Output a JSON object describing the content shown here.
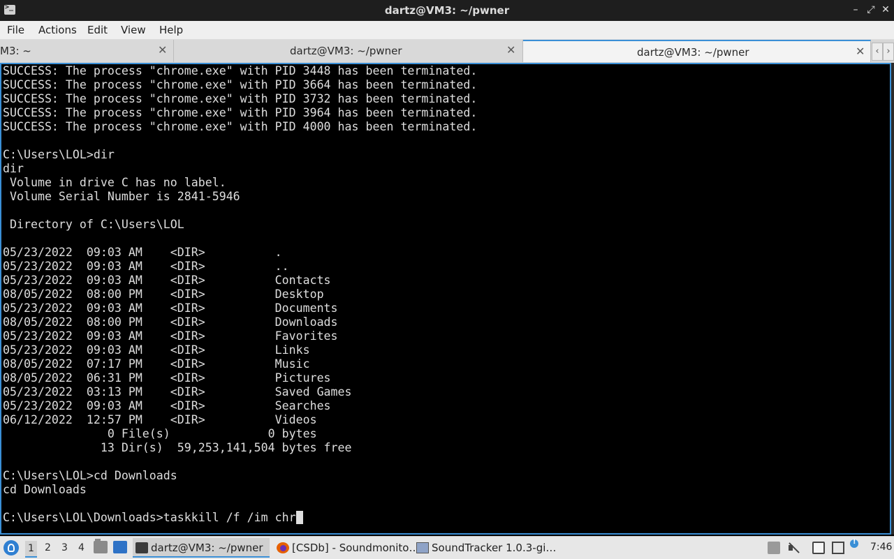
{
  "window": {
    "title": "dartz@VM3: ~/pwner",
    "controls": {
      "minimize": "–",
      "maximize": "⤢",
      "close": "✕"
    }
  },
  "menu": [
    "File",
    "Actions",
    "Edit",
    "View",
    "Help"
  ],
  "tabs": [
    {
      "label": "M3: ~",
      "close": "✕",
      "active": false
    },
    {
      "label": "dartz@VM3: ~/pwner",
      "close": "✕",
      "active": false
    },
    {
      "label": "dartz@VM3: ~/pwner",
      "close": "✕",
      "active": true
    }
  ],
  "tab_nav": {
    "left": "‹",
    "right": "›"
  },
  "terminal": {
    "lines": [
      "SUCCESS: The process \"chrome.exe\" with PID 3448 has been terminated.",
      "SUCCESS: The process \"chrome.exe\" with PID 3664 has been terminated.",
      "SUCCESS: The process \"chrome.exe\" with PID 3732 has been terminated.",
      "SUCCESS: The process \"chrome.exe\" with PID 3964 has been terminated.",
      "SUCCESS: The process \"chrome.exe\" with PID 4000 has been terminated.",
      "",
      "C:\\Users\\LOL>dir",
      "dir",
      " Volume in drive C has no label.",
      " Volume Serial Number is 2841-5946",
      "",
      " Directory of C:\\Users\\LOL",
      "",
      "05/23/2022  09:03 AM    <DIR>          .",
      "05/23/2022  09:03 AM    <DIR>          ..",
      "05/23/2022  09:03 AM    <DIR>          Contacts",
      "08/05/2022  08:00 PM    <DIR>          Desktop",
      "05/23/2022  09:03 AM    <DIR>          Documents",
      "08/05/2022  08:00 PM    <DIR>          Downloads",
      "05/23/2022  09:03 AM    <DIR>          Favorites",
      "05/23/2022  09:03 AM    <DIR>          Links",
      "08/05/2022  07:17 PM    <DIR>          Music",
      "08/05/2022  06:31 PM    <DIR>          Pictures",
      "05/23/2022  03:13 PM    <DIR>          Saved Games",
      "05/23/2022  09:03 AM    <DIR>          Searches",
      "06/12/2022  12:57 PM    <DIR>          Videos",
      "               0 File(s)              0 bytes",
      "              13 Dir(s)  59,253,141,504 bytes free",
      "",
      "C:\\Users\\LOL>cd Downloads",
      "cd Downloads",
      ""
    ],
    "prompt": "C:\\Users\\LOL\\Downloads>taskkill /f /im chr"
  },
  "taskbar": {
    "desktops": [
      "1",
      "2",
      "3",
      "4"
    ],
    "active_desktop": "1",
    "tasks": [
      {
        "label": "dartz@VM3: ~/pwner",
        "icon": "terminal-icon",
        "active": true
      },
      {
        "label": "[CSDb] - Soundmonito…",
        "icon": "firefox-icon",
        "active": false
      },
      {
        "label": "SoundTracker 1.0.3-gi…",
        "icon": "soundtracker-icon",
        "active": false
      }
    ],
    "clock": "7:46"
  }
}
